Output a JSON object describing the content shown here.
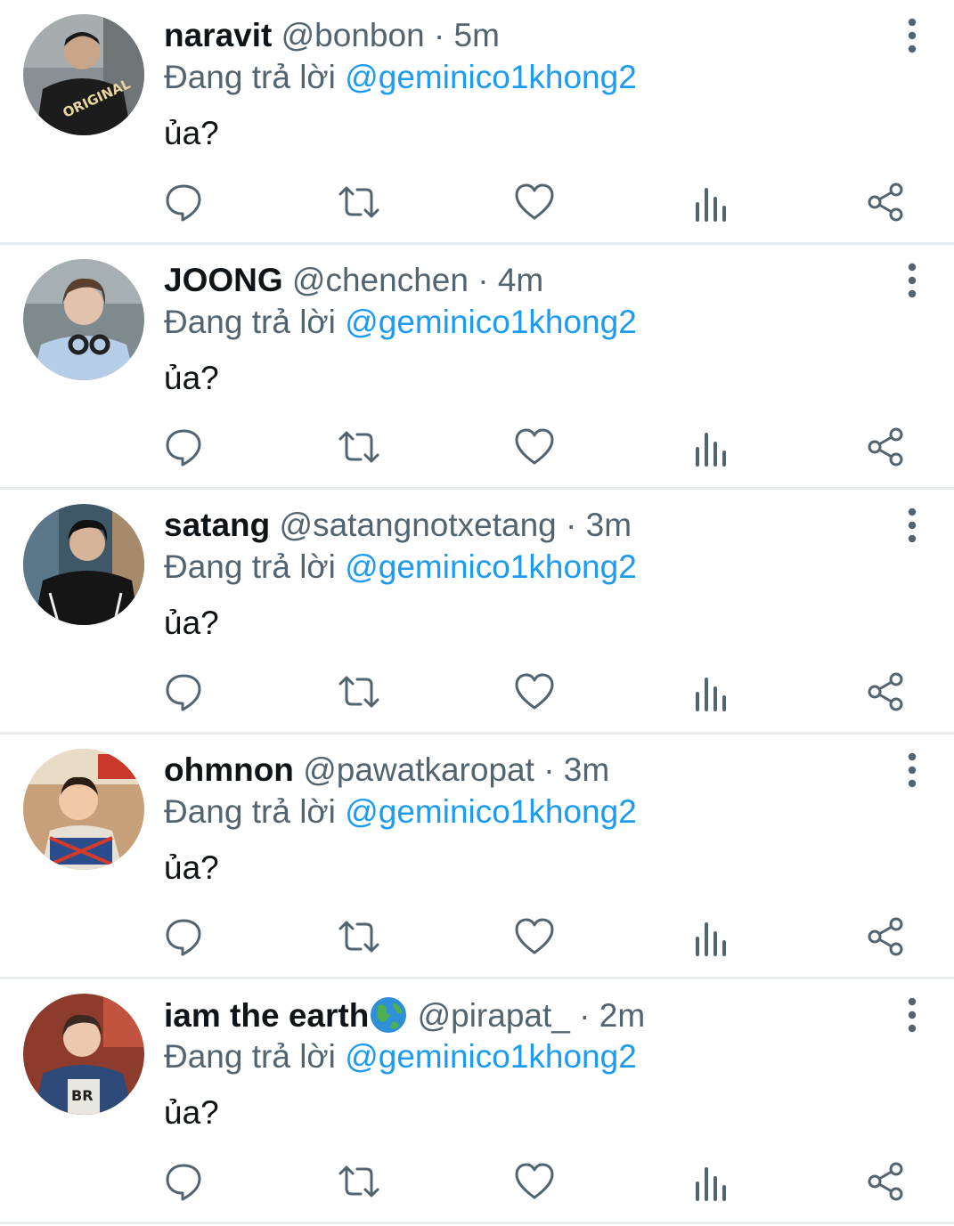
{
  "reply_prefix": "Đang trả lời",
  "separator": "·",
  "icons": {
    "reply": "reply-icon",
    "retweet": "retweet-icon",
    "like": "heart-icon",
    "views": "views-icon",
    "share": "share-icon",
    "more": "more-vertical-icon"
  },
  "colors": {
    "text": "#0f1419",
    "secondary": "#536471",
    "mention": "#1d9bf0",
    "divider": "#e9ecee"
  },
  "tweets": [
    {
      "display_name": "naravit",
      "handle": "@bonbon",
      "time": "5m",
      "reply_to": "@geminico1khong2",
      "text": "ủa?"
    },
    {
      "display_name": "JOONG",
      "handle": "@chenchen",
      "time": "4m",
      "reply_to": "@geminico1khong2",
      "text": "ủa?"
    },
    {
      "display_name": "satang",
      "handle": "@satangnotxetang",
      "time": "3m",
      "reply_to": "@geminico1khong2",
      "text": "ủa?"
    },
    {
      "display_name": "ohmnon",
      "handle": "@pawatkaropat",
      "time": "3m",
      "reply_to": "@geminico1khong2",
      "text": "ủa?"
    },
    {
      "display_name": "iam the earth",
      "name_emoji": "globe-icon",
      "handle": "@pirapat_",
      "time": "2m",
      "reply_to": "@geminico1khong2",
      "text": "ủa?"
    }
  ]
}
